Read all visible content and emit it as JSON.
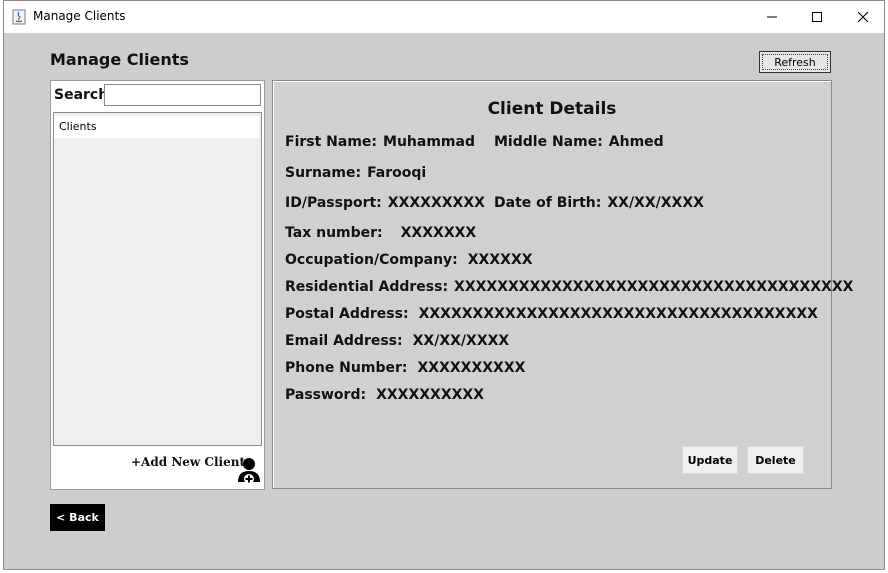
{
  "window": {
    "title": "Manage Clients"
  },
  "page": {
    "heading": "Manage Clients",
    "refresh_label": "Refresh"
  },
  "left": {
    "search_label": "Search",
    "search_value": "",
    "list_items": [
      "Clients"
    ],
    "add_label": "+Add New Client"
  },
  "details": {
    "title": "Client Details",
    "first_name": {
      "label": "First Name:",
      "value": "Muhammad"
    },
    "middle_name": {
      "label": "Middle Name:",
      "value": "Ahmed"
    },
    "surname": {
      "label": "Surname:",
      "value": "Farooqi"
    },
    "id_passport": {
      "label": "ID/Passport:",
      "value": "XXXXXXXXX"
    },
    "dob": {
      "label": "Date of Birth:",
      "value": "XX/XX/XXXX"
    },
    "tax": {
      "label": "Tax number:",
      "value": "XXXXXXX"
    },
    "occupation": {
      "label": "Occupation/Company:",
      "value": "XXXXXX"
    },
    "residential": {
      "label": "Residential Address:",
      "value": "XXXXXXXXXXXXXXXXXXXXXXXXXXXXXXXXXXXXX"
    },
    "postal": {
      "label": "Postal Address:",
      "value": "XXXXXXXXXXXXXXXXXXXXXXXXXXXXXXXXXXXXX"
    },
    "email": {
      "label": "Email Address:",
      "value": "XX/XX/XXXX"
    },
    "phone": {
      "label": "Phone Number:",
      "value": "XXXXXXXXXX"
    },
    "password": {
      "label": "Password:",
      "value": "XXXXXXXXXX"
    },
    "update_label": "Update",
    "delete_label": "Delete"
  },
  "back_label": "< Back"
}
